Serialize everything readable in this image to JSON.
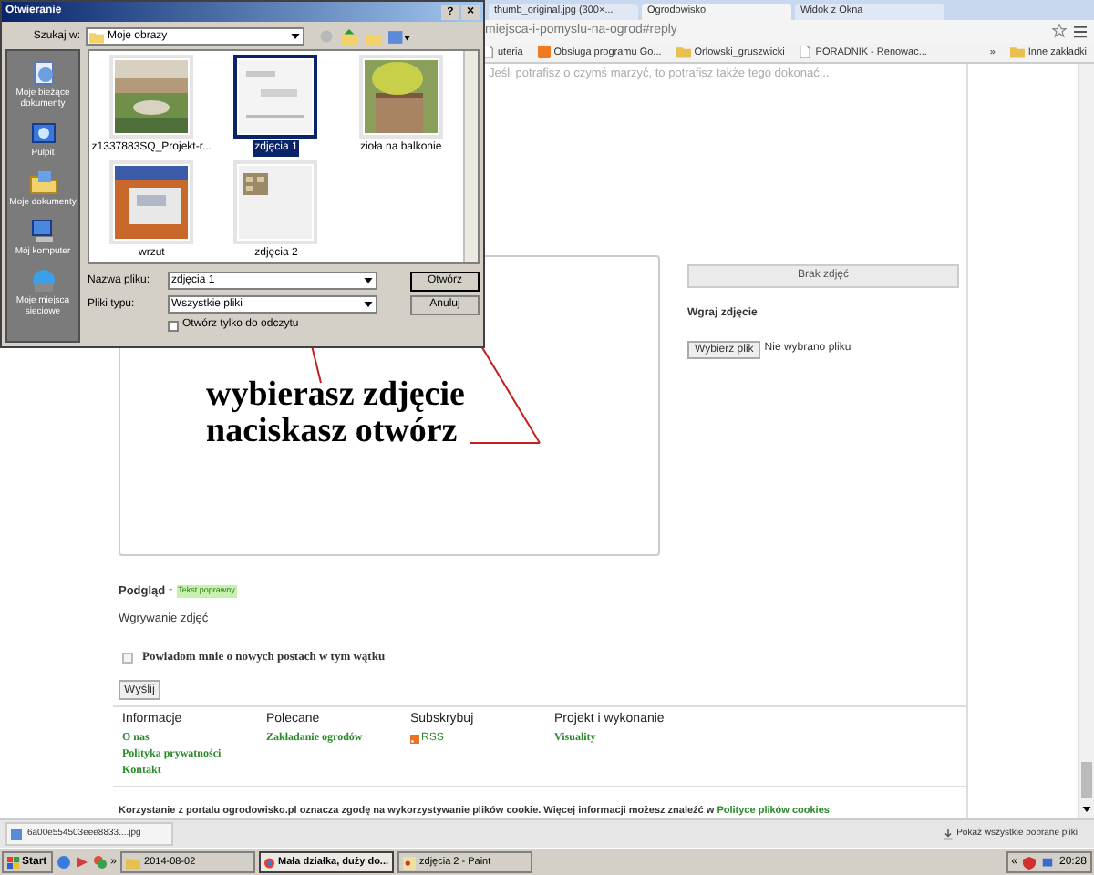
{
  "browser": {
    "tabs": [
      {
        "label": "thumb_original.jpg (300×...",
        "selected": false
      },
      {
        "label": "Ogrodowisko",
        "selected": true
      },
      {
        "label": "Widok z Okna",
        "selected": false
      }
    ],
    "address": "miejsca-i-pomyslu-na-ogrod#reply",
    "bookmarks": [
      {
        "label": "uteria",
        "kind": "page"
      },
      {
        "label": "Obsługa programu Go...",
        "kind": "blogger"
      },
      {
        "label": "Orlowski_gruszwicki",
        "kind": "folder"
      },
      {
        "label": "PORADNIK - Renowac...",
        "kind": "page"
      }
    ],
    "more_bookmarks": "»",
    "other_bookmarks": "Inne zakładki"
  },
  "page": {
    "motto": "Jeśli potrafisz o czymś marzyć, to potrafisz także tego dokonać...",
    "photos_button": "Brak zdjęć",
    "upload_heading": "Wgraj zdjęcie",
    "choose_file_button": "Wybierz plik",
    "no_file_text": "Nie wybrano pliku",
    "preview_label": "Podgląd",
    "preview_separator": "-",
    "preview_status": "Tekst poprawny",
    "uploading_label": "Wgrywanie zdjęć",
    "notify": {
      "label": "Powiadom mnie o nowych postach w tym wątku",
      "checked": false
    },
    "send_button": "Wyślij",
    "footer": [
      {
        "heading": "Informacje",
        "links": [
          {
            "label": "O nas",
            "kind": "link"
          },
          {
            "label": "Polityka prywatności",
            "kind": "link"
          },
          {
            "label": "Kontakt",
            "kind": "link"
          }
        ]
      },
      {
        "heading": "Polecane",
        "links": [
          {
            "label": "Zakładanie ogrodów",
            "kind": "link"
          }
        ]
      },
      {
        "heading": "Subskrybuj",
        "links": [
          {
            "label": "RSS",
            "kind": "feed"
          }
        ]
      },
      {
        "heading": "Projekt i wykonanie",
        "links": [
          {
            "label": "Visuality",
            "kind": "link"
          }
        ]
      }
    ],
    "cookie_notice": "Korzystanie z portalu ogrodowisko.pl oznacza zgodę na wykorzystywanie plików cookie. Więcej informacji możesz znaleźć w",
    "cookie_links": [
      "Polityce",
      "plików cookies"
    ]
  },
  "annotation": {
    "lines": [
      "wybierasz zdjęcie",
      "naciskasz otwórz"
    ]
  },
  "dialog": {
    "title": "Otwieranie",
    "help_button": "?",
    "close_button": "×",
    "look_in_label": "Szukaj w:",
    "look_in_value": "Moje obrazy",
    "places": [
      {
        "label": "Moje bieżące dokumenty",
        "kind": "recent"
      },
      {
        "label": "Pulpit",
        "kind": "desktop"
      },
      {
        "label": "Moje dokumenty",
        "kind": "documents"
      },
      {
        "label": "Mój komputer",
        "kind": "computer"
      },
      {
        "label": "Moje miejsca sieciowe",
        "kind": "network"
      }
    ],
    "files": [
      {
        "name": "z1337883SQ_Projekt-r...",
        "selected": false
      },
      {
        "name": "zdjęcia 1",
        "selected": true
      },
      {
        "name": "zioła na balkonie",
        "selected": false
      },
      {
        "name": "wrzut",
        "selected": false
      },
      {
        "name": "zdjęcia 2",
        "selected": false
      }
    ],
    "file_name_label": "Nazwa pliku:",
    "file_name_value": "zdjęcia 1",
    "file_type_label": "Pliki typu:",
    "file_type_value": "Wszystkie pliki",
    "read_only": {
      "label": "Otwórz tylko do odczytu",
      "checked": false
    },
    "open_button": "Otwórz",
    "cancel_button": "Anuluj"
  },
  "downloads": {
    "file": "6a00e554503eee8833....jpg",
    "show_all": "Pokaż wszystkie pobrane pliki"
  },
  "taskbar": {
    "start": "Start",
    "more": "»",
    "windows": [
      {
        "label": "2014-08-02",
        "kind": "folder",
        "selected": false
      },
      {
        "label": "Mała działka, duży do...",
        "kind": "browser",
        "selected": true
      },
      {
        "label": "zdjęcia 2 - Paint",
        "kind": "paint",
        "selected": false
      }
    ],
    "tray_expand": "«",
    "clock": "20:28"
  }
}
